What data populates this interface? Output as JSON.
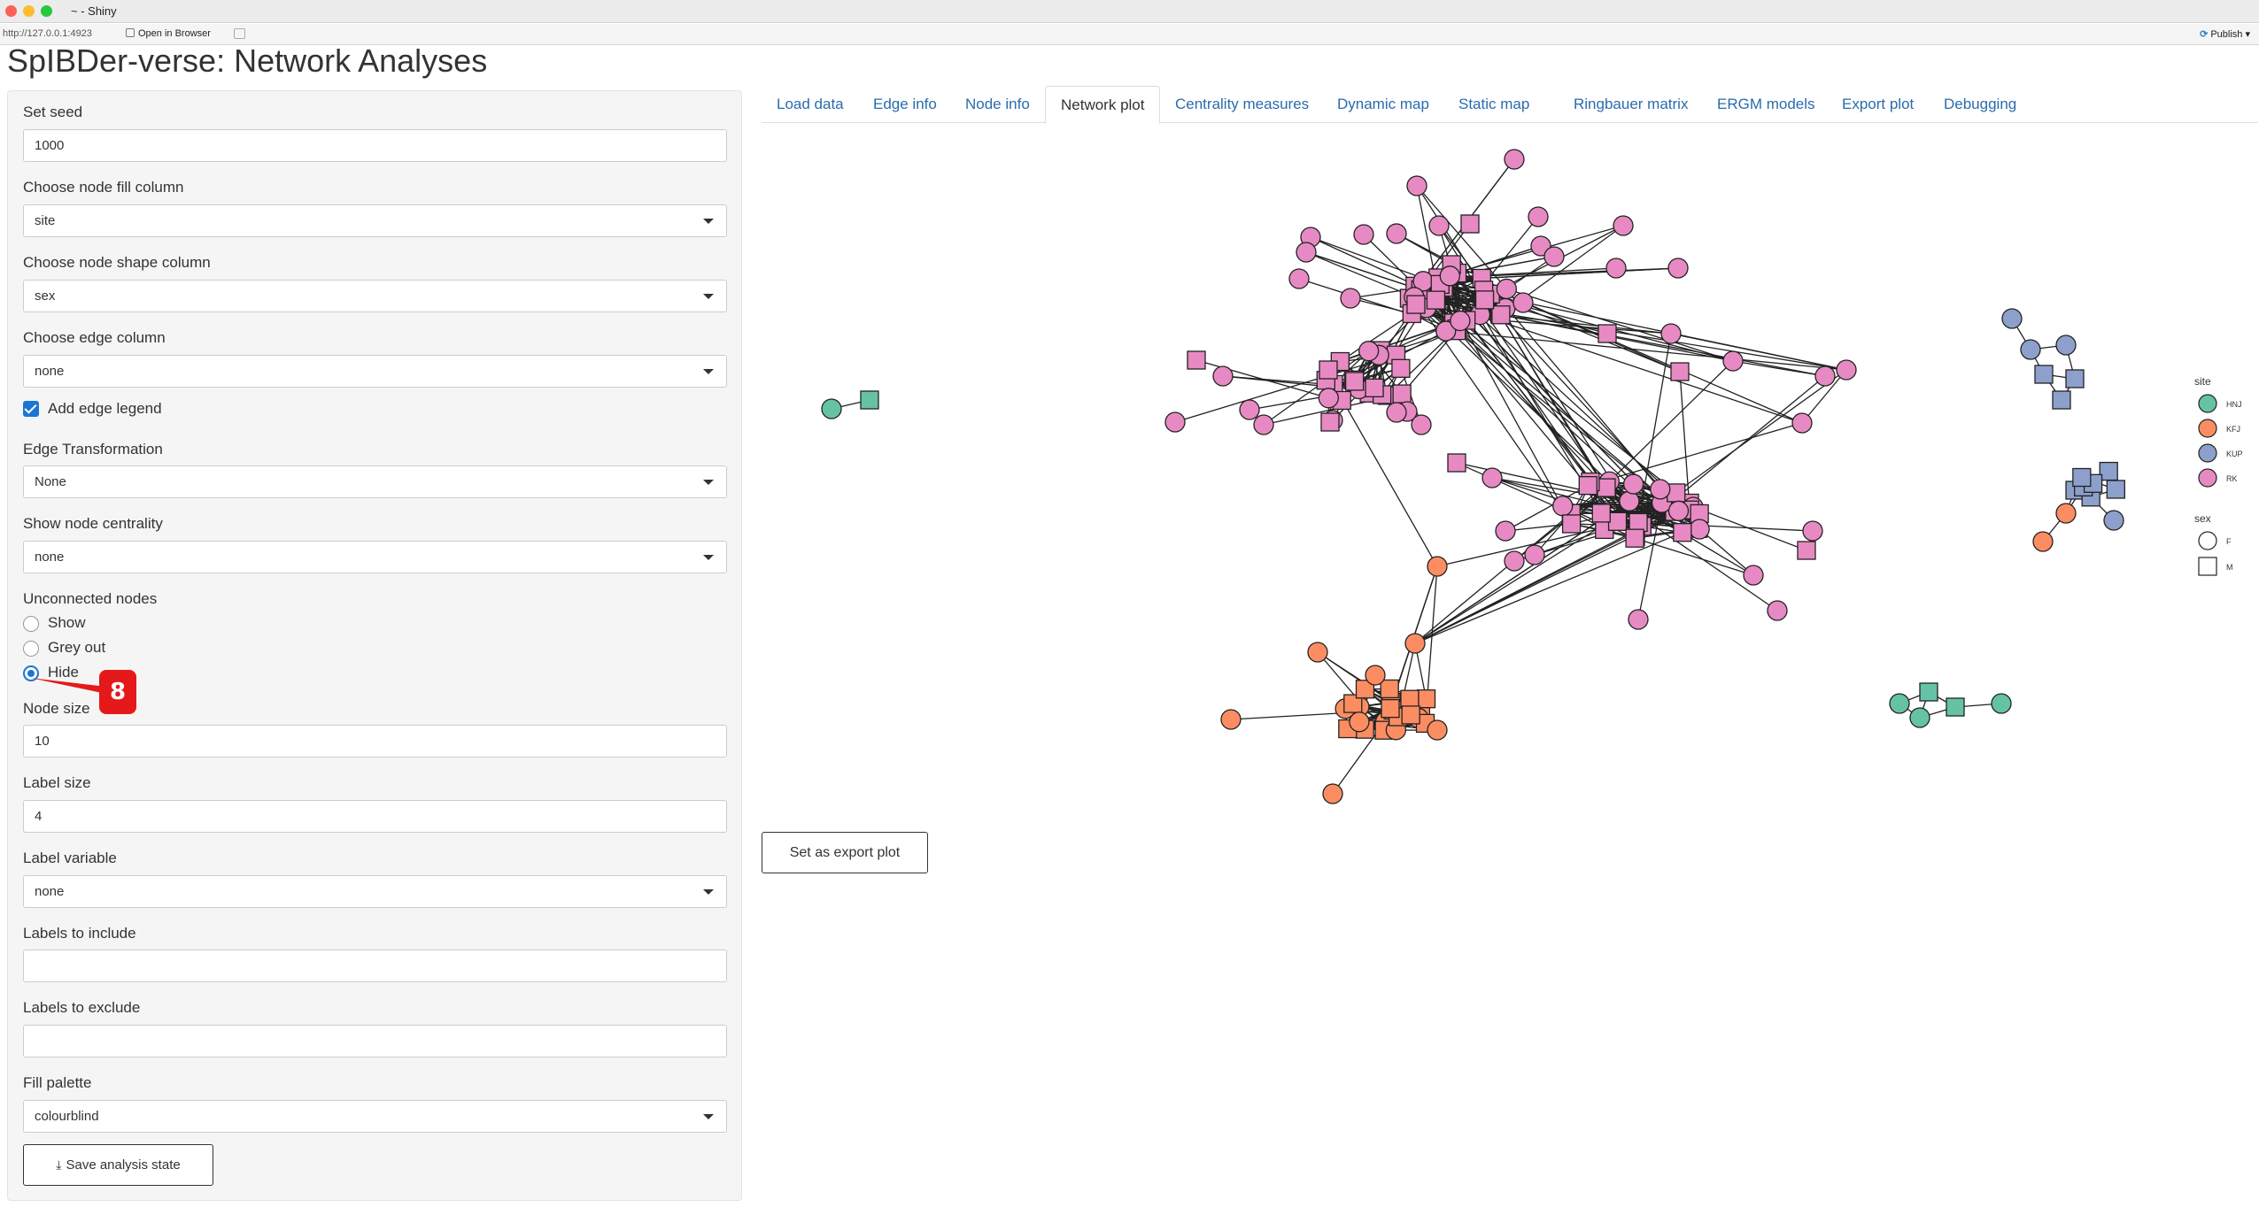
{
  "window": {
    "title": "~ - Shiny"
  },
  "toolbar": {
    "url": "http://127.0.0.1:4923",
    "open_in_browser": "Open in Browser",
    "publish": "Publish"
  },
  "app": {
    "title": "SpIBDer-verse: Network Analyses"
  },
  "sidebar": {
    "seed": {
      "label": "Set seed",
      "value": "1000"
    },
    "node_fill": {
      "label": "Choose node fill column",
      "value": "site"
    },
    "node_shape": {
      "label": "Choose node shape column",
      "value": "sex"
    },
    "edge_column": {
      "label": "Choose edge column",
      "value": "none"
    },
    "edge_legend": {
      "label": "Add edge legend",
      "checked": true
    },
    "edge_transform": {
      "label": "Edge Transformation",
      "value": "None"
    },
    "centrality": {
      "label": "Show node centrality",
      "value": "none"
    },
    "unconnected": {
      "label": "Unconnected nodes",
      "options": [
        "Show",
        "Grey out",
        "Hide"
      ],
      "selected": "Hide"
    },
    "node_size": {
      "label": "Node size",
      "value": "10"
    },
    "label_size": {
      "label": "Label size",
      "value": "4"
    },
    "label_variable": {
      "label": "Label variable",
      "value": "none"
    },
    "labels_include": {
      "label": "Labels to include",
      "value": ""
    },
    "labels_exclude": {
      "label": "Labels to exclude",
      "value": ""
    },
    "fill_palette": {
      "label": "Fill palette",
      "value": "colourblind"
    },
    "save_button": "Save analysis state"
  },
  "annotation": {
    "step_badge": "8"
  },
  "tabs": [
    "Load data",
    "Edge info",
    "Node info",
    "Network plot",
    "Centrality measures",
    "Dynamic map",
    "Static map",
    "Ringbauer matrix",
    "ERGM models",
    "Export plot",
    "Debugging"
  ],
  "active_tab": "Network plot",
  "legend": {
    "site_title": "site",
    "sites": [
      {
        "name": "HNJ",
        "color": "#66c2a5"
      },
      {
        "name": "KFJ",
        "color": "#fc8d62"
      },
      {
        "name": "KUP",
        "color": "#8da0cb"
      },
      {
        "name": "RK",
        "color": "#e78ac3"
      }
    ],
    "sex_title": "sex",
    "sexes": [
      "F",
      "M"
    ]
  },
  "export_button": "Set as export plot"
}
